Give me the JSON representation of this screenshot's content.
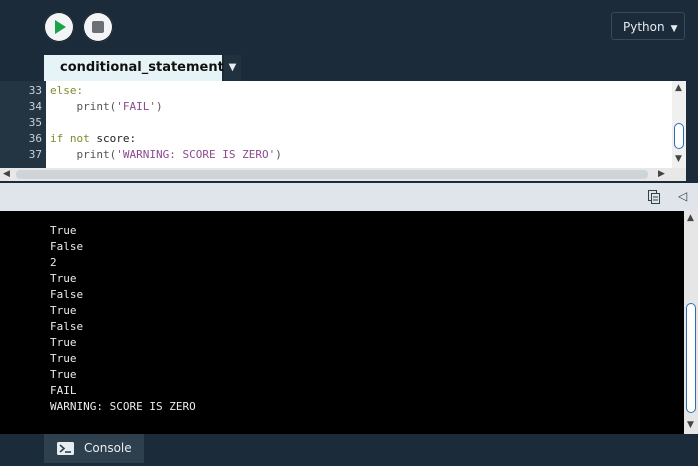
{
  "toolbar": {
    "language_label": "Python",
    "language_caret": "▼"
  },
  "editor": {
    "tab_name": "conditional_statements",
    "tab_menu_caret": "▼",
    "lines": [
      {
        "num": "33",
        "tokens": [
          {
            "t": "else:",
            "k": "kw"
          }
        ]
      },
      {
        "num": "34",
        "tokens": [
          {
            "t": "    ",
            "k": ""
          },
          {
            "t": "print(",
            "k": "fn"
          },
          {
            "t": "'FAIL'",
            "k": "str"
          },
          {
            "t": ")",
            "k": "fn"
          }
        ]
      },
      {
        "num": "35",
        "tokens": []
      },
      {
        "num": "36",
        "tokens": [
          {
            "t": "if not",
            "k": "kw"
          },
          {
            "t": " score:",
            "k": ""
          }
        ]
      },
      {
        "num": "37",
        "tokens": [
          {
            "t": "    ",
            "k": ""
          },
          {
            "t": "print(",
            "k": "fn"
          },
          {
            "t": "'WARNING: SCORE IS ZERO'",
            "k": "str"
          },
          {
            "t": ")",
            "k": "fn"
          }
        ]
      }
    ]
  },
  "console": {
    "output": [
      "True",
      "False",
      "2",
      "True",
      "False",
      "True",
      "False",
      "True",
      "True",
      "True",
      "FAIL",
      "WARNING: SCORE IS ZERO"
    ]
  },
  "bottom": {
    "console_tab_label": "Console"
  },
  "colors": {
    "background": "#1b2b3a",
    "play_green": "#1aa34a",
    "editor_bg": "#ffffff",
    "console_bg": "#000000"
  }
}
